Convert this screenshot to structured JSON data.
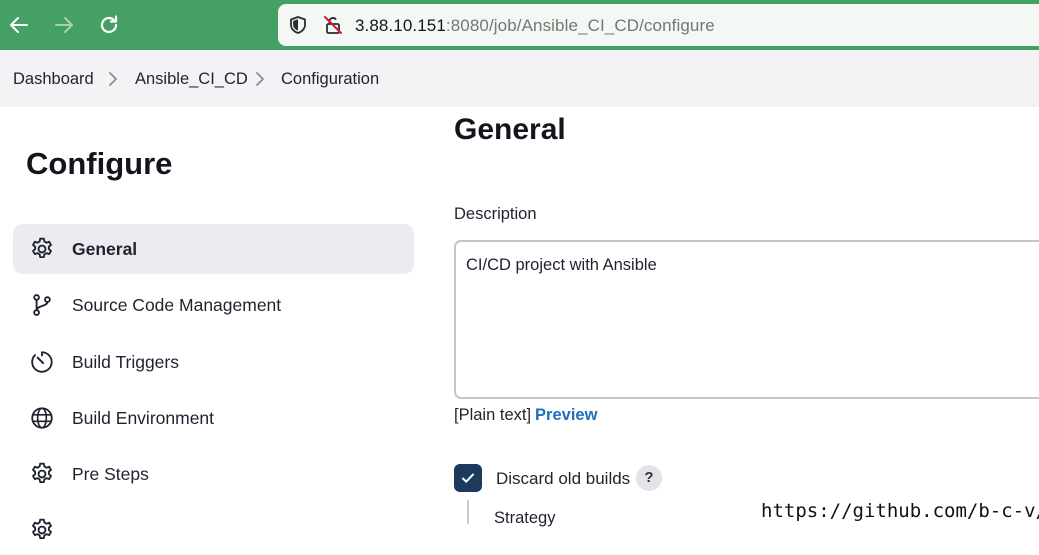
{
  "browser": {
    "url_host": "3.88.10.151",
    "url_path": ":8080/job/Ansible_CI_CD/configure",
    "icons": [
      "back-arrow-icon",
      "forward-arrow-icon",
      "reload-icon",
      "shield-icon",
      "insecure-lock-icon"
    ]
  },
  "breadcrumb": {
    "items": [
      "Dashboard",
      "Ansible_CI_CD",
      "Configuration"
    ]
  },
  "sidebar": {
    "title": "Configure",
    "items": [
      {
        "label": "General",
        "icon": "gear-icon",
        "active": true
      },
      {
        "label": "Source Code Management",
        "icon": "branch-icon",
        "active": false
      },
      {
        "label": "Build Triggers",
        "icon": "timer-icon",
        "active": false
      },
      {
        "label": "Build Environment",
        "icon": "globe-icon",
        "active": false
      },
      {
        "label": "Pre Steps",
        "icon": "gear-icon",
        "active": false
      }
    ]
  },
  "main": {
    "title": "General",
    "description_label": "Description",
    "description_value": "CI/CD project with Ansible",
    "plain_text_note": "[Plain text]",
    "preview_label": "Preview",
    "discard_label": "Discard old builds",
    "discard_checked": true,
    "help_label": "?",
    "strategy_label": "Strategy"
  },
  "watermark": "https://github.com/b-c-v/",
  "colors": {
    "chrome": "#45a163",
    "crumb_bar": "#f3f3f5",
    "active_item": "#ebebf0",
    "checkbox": "#1b3a5c",
    "link": "#1f6fbf"
  }
}
